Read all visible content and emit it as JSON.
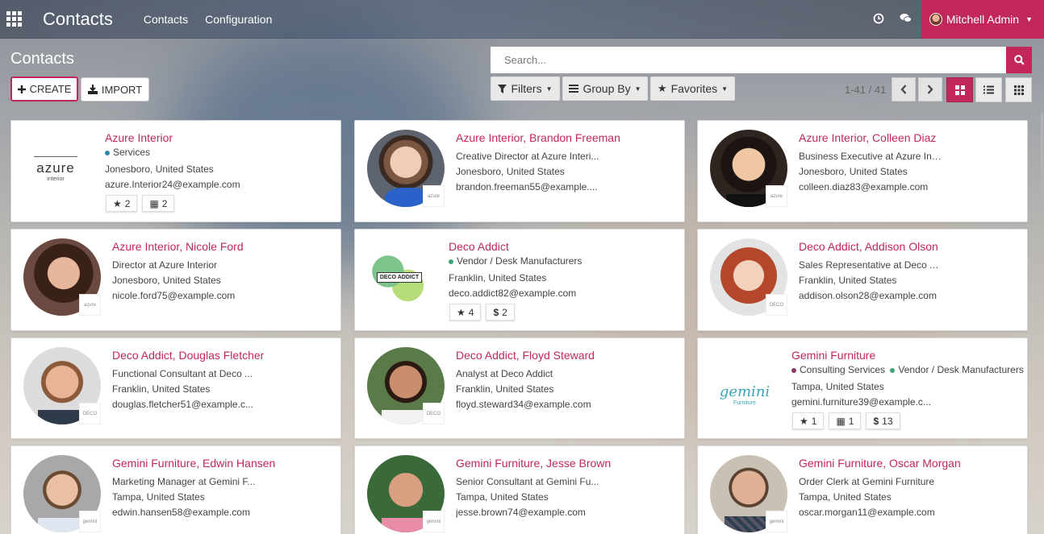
{
  "navbar": {
    "app_title": "Contacts",
    "menu": [
      "Contacts",
      "Configuration"
    ],
    "user_name": "Mitchell Admin"
  },
  "control_panel": {
    "breadcrumb": "Contacts",
    "create_label": "CREATE",
    "import_label": "IMPORT",
    "search_placeholder": "Search...",
    "filters_label": "Filters",
    "groupby_label": "Group By",
    "favorites_label": "Favorites",
    "pager": "1-41 / 41"
  },
  "colors": {
    "accent": "#c1275a",
    "tag_blue": "#2e86a8",
    "tag_green": "#3aa574",
    "tag_purple": "#8a3a6a"
  },
  "cards": [
    {
      "name": "Azure Interior",
      "tags": [
        {
          "label": "Services",
          "color": "#2e86a8"
        }
      ],
      "lines": [
        "Jonesboro, United States",
        "azure.Interior24@example.com"
      ],
      "badges": [
        {
          "icon": "star-icon",
          "value": "2"
        },
        {
          "icon": "calendar-icon",
          "value": "2"
        }
      ],
      "logo": "azure",
      "logo_sub": "interior"
    },
    {
      "name": "Azure Interior, Brandon Freeman",
      "lines": [
        "Creative Director at Azure Interi...",
        "Jonesboro, United States",
        "brandon.freeman55@example...."
      ],
      "mini": "azure"
    },
    {
      "name": "Azure Interior, Colleen Diaz",
      "lines": [
        "Business Executive at Azure Int...",
        "Jonesboro, United States",
        "colleen.diaz83@example.com"
      ],
      "mini": "azure"
    },
    {
      "name": "Azure Interior, Nicole Ford",
      "lines": [
        "Director at Azure Interior",
        "Jonesboro, United States",
        "nicole.ford75@example.com"
      ],
      "mini": "azure"
    },
    {
      "name": "Deco Addict",
      "tags": [
        {
          "label": "Vendor / Desk Manufacturers",
          "color": "#3aa574"
        }
      ],
      "lines": [
        "Franklin, United States",
        "deco.addict82@example.com"
      ],
      "badges": [
        {
          "icon": "star-icon",
          "value": "4"
        },
        {
          "icon": "dollar-icon",
          "value": "2"
        }
      ],
      "logo": "DECO ADDICT"
    },
    {
      "name": "Deco Addict, Addison Olson",
      "lines": [
        "Sales Representative at Deco A...",
        "Franklin, United States",
        "addison.olson28@example.com"
      ],
      "mini": "DECO"
    },
    {
      "name": "Deco Addict, Douglas Fletcher",
      "lines": [
        "Functional Consultant at Deco ...",
        "Franklin, United States",
        "douglas.fletcher51@example.c..."
      ],
      "mini": "DECO"
    },
    {
      "name": "Deco Addict, Floyd Steward",
      "lines": [
        "Analyst at Deco Addict",
        "Franklin, United States",
        "floyd.steward34@example.com"
      ],
      "mini": "DECO"
    },
    {
      "name": "Gemini Furniture",
      "tags": [
        {
          "label": "Consulting Services",
          "color": "#8a3a6a"
        },
        {
          "label": "Vendor / Desk Manufacturers",
          "color": "#3aa574"
        }
      ],
      "lines": [
        "Tampa, United States",
        "gemini.furniture39@example.c..."
      ],
      "badges": [
        {
          "icon": "star-icon",
          "value": "1"
        },
        {
          "icon": "calendar-icon",
          "value": "1"
        },
        {
          "icon": "dollar-icon",
          "value": "13"
        }
      ],
      "logo": "gemini",
      "logo_sub": "Furniture"
    },
    {
      "name": "Gemini Furniture, Edwin Hansen",
      "lines": [
        "Marketing Manager at Gemini F...",
        "Tampa, United States",
        "edwin.hansen58@example.com"
      ],
      "mini": "gemini"
    },
    {
      "name": "Gemini Furniture, Jesse Brown",
      "lines": [
        "Senior Consultant at Gemini Fu...",
        "Tampa, United States",
        "jesse.brown74@example.com"
      ],
      "mini": "gemini"
    },
    {
      "name": "Gemini Furniture, Oscar Morgan",
      "lines": [
        "Order Clerk at Gemini Furniture",
        "Tampa, United States",
        "oscar.morgan11@example.com"
      ],
      "mini": "gemini"
    }
  ]
}
